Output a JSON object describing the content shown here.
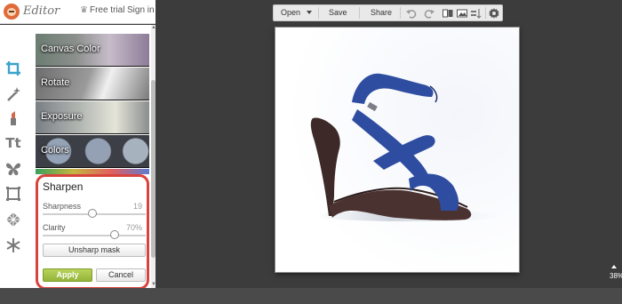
{
  "header": {
    "logo_text": "Editor",
    "free_trial": "Free trial",
    "sign_in": "Sign in"
  },
  "tools": [
    {
      "name": "crop-icon",
      "active": true
    },
    {
      "name": "magic-wand-icon"
    },
    {
      "name": "lipstick-icon"
    },
    {
      "name": "text-icon",
      "label": "Tt"
    },
    {
      "name": "butterfly-icon"
    },
    {
      "name": "frame-icon"
    },
    {
      "name": "texture-icon"
    },
    {
      "name": "snowflake-icon"
    }
  ],
  "gallery": {
    "items": [
      "Canvas Color",
      "Rotate",
      "Exposure",
      "Colors"
    ]
  },
  "sharpen": {
    "title": "Sharpen",
    "sharpness_label": "Sharpness",
    "sharpness_value": "19",
    "sharpness_level": 0.48,
    "clarity_label": "Clarity",
    "clarity_value": "70%",
    "clarity_level": 0.7,
    "unsharp_label": "Unsharp mask",
    "apply_label": "Apply",
    "cancel_label": "Cancel",
    "accent": "#d9433e",
    "apply_color": "#a6c34a"
  },
  "toolbar": {
    "open_label": "Open",
    "save_label": "Save",
    "share_label": "Share"
  },
  "canvas": {
    "shoe_color": "#2f4da0",
    "sole_color": "#3d2a28"
  },
  "zoom": {
    "level": "38%"
  }
}
